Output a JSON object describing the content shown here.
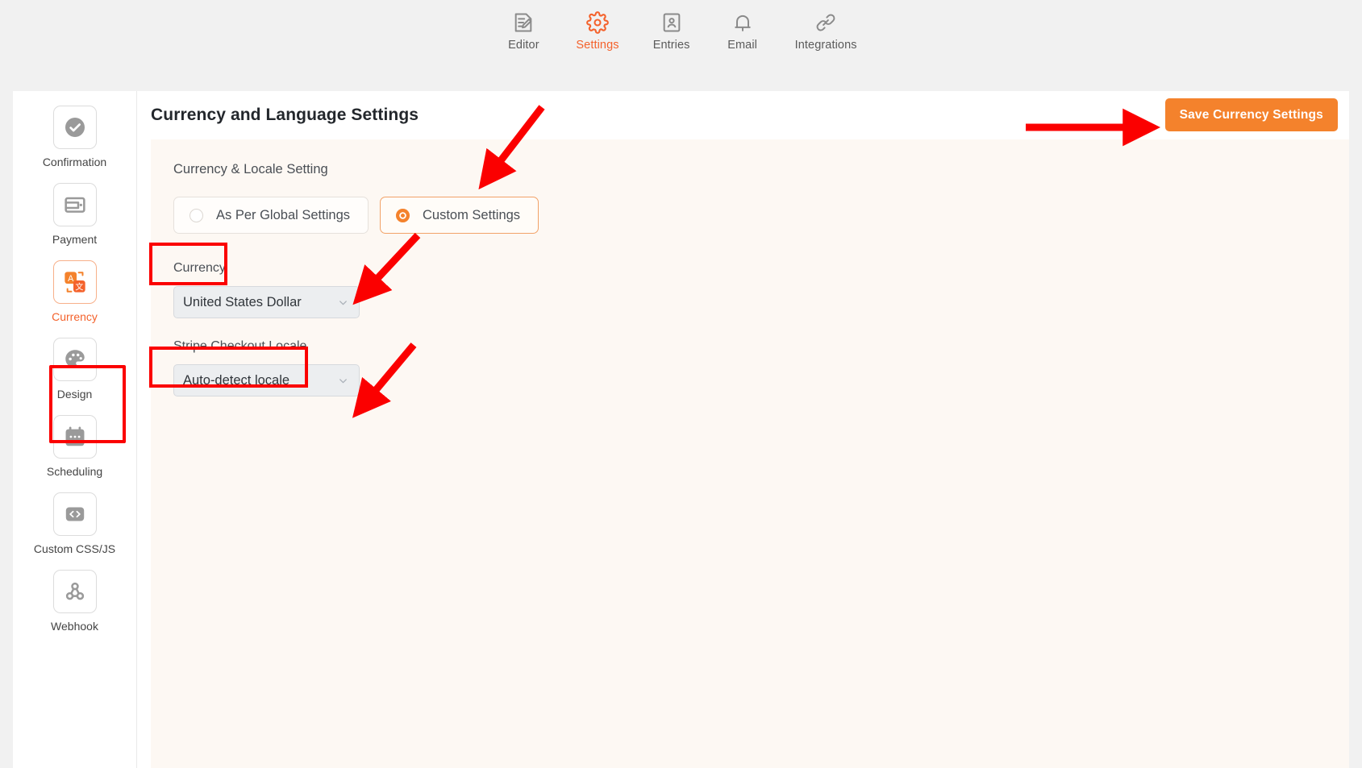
{
  "topnav": {
    "items": [
      {
        "label": "Editor",
        "icon": "document-edit-icon",
        "active": false
      },
      {
        "label": "Settings",
        "icon": "gear-icon",
        "active": true
      },
      {
        "label": "Entries",
        "icon": "contact-card-icon",
        "active": false
      },
      {
        "label": "Email",
        "icon": "bell-icon",
        "active": false
      },
      {
        "label": "Integrations",
        "icon": "link-icon",
        "active": false
      }
    ]
  },
  "sidebar": {
    "items": [
      {
        "label": "Confirmation",
        "icon": "check-circle-icon",
        "active": false
      },
      {
        "label": "Payment",
        "icon": "wallet-icon",
        "active": false
      },
      {
        "label": "Currency",
        "icon": "translate-icon",
        "active": true
      },
      {
        "label": "Design",
        "icon": "palette-icon",
        "active": false
      },
      {
        "label": "Scheduling",
        "icon": "calendar-icon",
        "active": false
      },
      {
        "label": "Custom CSS/JS",
        "icon": "code-brackets-icon",
        "active": false
      },
      {
        "label": "Webhook",
        "icon": "webhook-icon",
        "active": false
      }
    ]
  },
  "header": {
    "title": "Currency and Language Settings",
    "save_label": "Save Currency Settings"
  },
  "panel": {
    "section_title": "Currency & Locale Setting",
    "mode_options": [
      {
        "label": "As Per Global Settings",
        "selected": false
      },
      {
        "label": "Custom Settings",
        "selected": true
      }
    ],
    "fields": [
      {
        "label": "Currency",
        "value": "United States Dollar"
      },
      {
        "label": "Stripe Checkout Locale",
        "value": "Auto-detect locale"
      }
    ]
  },
  "colors": {
    "accent": "#f4622c",
    "button": "#f4822c",
    "annotation": "#fb0000",
    "panel_bg": "#fdf8f3",
    "page_bg": "#f1f1f1"
  }
}
